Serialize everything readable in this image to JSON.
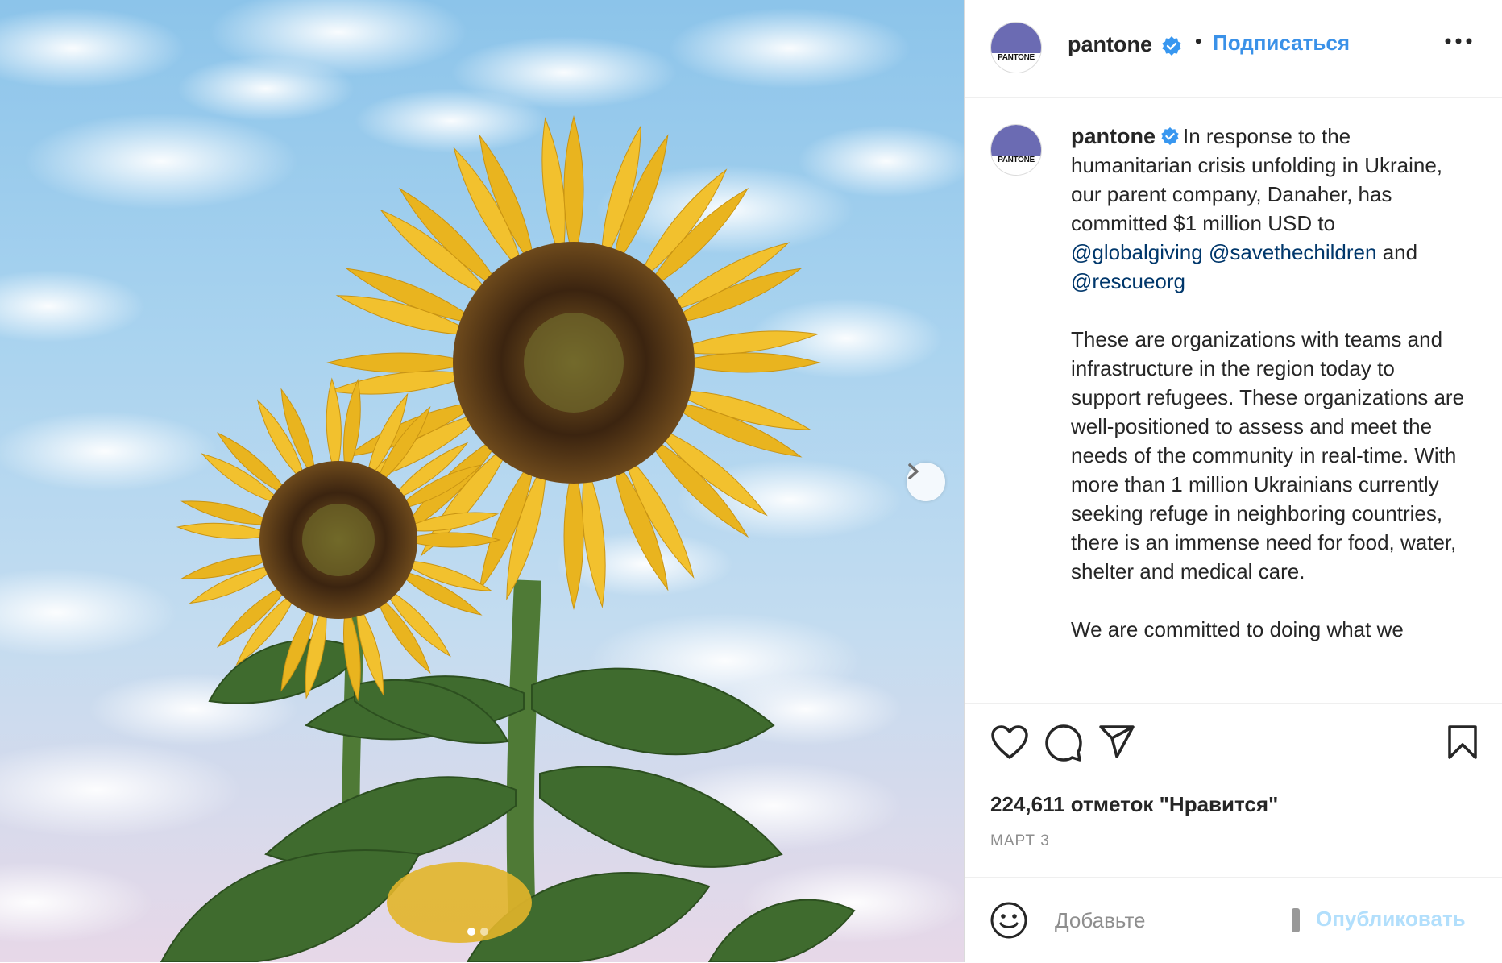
{
  "header": {
    "username": "pantone",
    "separator": "•",
    "follow_label": "Подписаться",
    "avatar_text": "PANTONE"
  },
  "caption": {
    "username": "pantone",
    "line1": "In response to the humanitarian crisis unfolding in Ukraine, our parent company, Danaher, has committed $1 million USD to",
    "mention1": "@globalgiving",
    "mention2": "@savethechildren",
    "and_text": "and",
    "mention3": "@rescueorg",
    "paragraph2": "These are organizations with teams and infrastructure in the region today to support refugees. These organizations are well-positioned to assess and meet the needs of the community in real-time. With more than 1 million Ukrainians currently seeking refuge in neighboring countries, there is an immense need for food, water, shelter and medical care.",
    "paragraph3": "We are committed to doing what we"
  },
  "post": {
    "likes_text": "224,611 отметок \"Нравится\"",
    "date_text": "МАРТ 3",
    "carousel_total": 2,
    "carousel_active": 1
  },
  "comment": {
    "placeholder": "Добавьте",
    "publish_label": "Опубликовать"
  },
  "icons": {
    "verified": "verified-badge-icon",
    "more": "more-options-icon",
    "like": "heart-icon",
    "comment": "comment-icon",
    "share": "paper-plane-icon",
    "save": "bookmark-icon",
    "emoji": "smiley-icon",
    "next": "chevron-right-icon"
  },
  "colors": {
    "link": "#3a91e8",
    "mention": "#00376b",
    "publish_disabled": "#b2dffc",
    "avatar_purple": "#6b6bb3"
  }
}
